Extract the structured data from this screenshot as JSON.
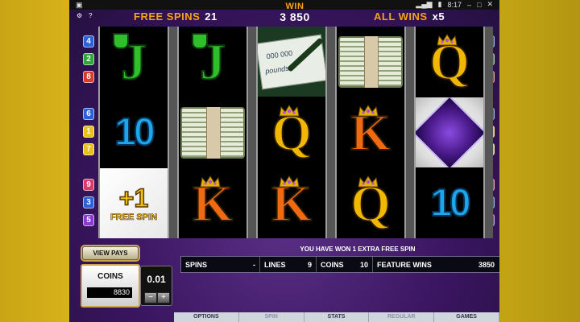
{
  "status_bar": {
    "time": "8:17",
    "left_icon": "app-icon"
  },
  "side_buttons": {
    "settings": "⚙",
    "help": "?"
  },
  "hud": {
    "free_spins_label": "FREE SPINS",
    "free_spins_value": "21",
    "win_label": "WIN",
    "win_value": "3 850",
    "all_wins_label": "ALL WINS",
    "all_wins_value": "x5"
  },
  "paylines_left": [
    "4",
    "2",
    "8",
    "6",
    "1",
    "7",
    "9",
    "3",
    "5"
  ],
  "paylines_right": [
    "4",
    "2",
    "8",
    "6",
    "1",
    "7",
    "9",
    "3",
    "5"
  ],
  "payline_colors": {
    "1": "#e8c21a",
    "2": "#2fa63a",
    "3": "#2c62d8",
    "4": "#2c62d8",
    "5": "#8a3ad0",
    "6": "#2c62d8",
    "7": "#e8c21a",
    "8": "#d83a2c",
    "9": "#d83a6a"
  },
  "reels": [
    [
      "J",
      "10",
      "+1 FREE SPIN"
    ],
    [
      "J",
      "money",
      "K"
    ],
    [
      "cheque",
      "Q",
      "K"
    ],
    [
      "money",
      "K",
      "Q"
    ],
    [
      "Q",
      "diamond",
      "10"
    ]
  ],
  "free_spin_symbol": {
    "plus": "+1",
    "label": "FREE SPIN"
  },
  "cheque_text": {
    "amount": "000 000",
    "words": "pounds"
  },
  "message": "YOU HAVE WON 1 EXTRA FREE SPIN",
  "info": {
    "spins_label": "SPINS",
    "spins_value": "-",
    "lines_label": "LINES",
    "lines_value": "9",
    "coins_label": "COINS",
    "coins_value": "10",
    "feature_label": "FEATURE WINS",
    "feature_value": "3850"
  },
  "view_pays": "VIEW PAYS",
  "coins_box": {
    "label": "COINS",
    "value": "8830"
  },
  "denomination": {
    "value": "0.01",
    "minus": "−",
    "plus": "+"
  },
  "menu": [
    {
      "label": "OPTIONS",
      "dim": false
    },
    {
      "label": "SPIN",
      "dim": true
    },
    {
      "label": "STATS",
      "dim": false
    },
    {
      "label": "REGULAR",
      "dim": true
    },
    {
      "label": "GAMES",
      "dim": false
    }
  ],
  "colors": {
    "accent_orange": "#f6a21a",
    "frame_purple": "#3a1560",
    "gold": "#caa64c"
  }
}
